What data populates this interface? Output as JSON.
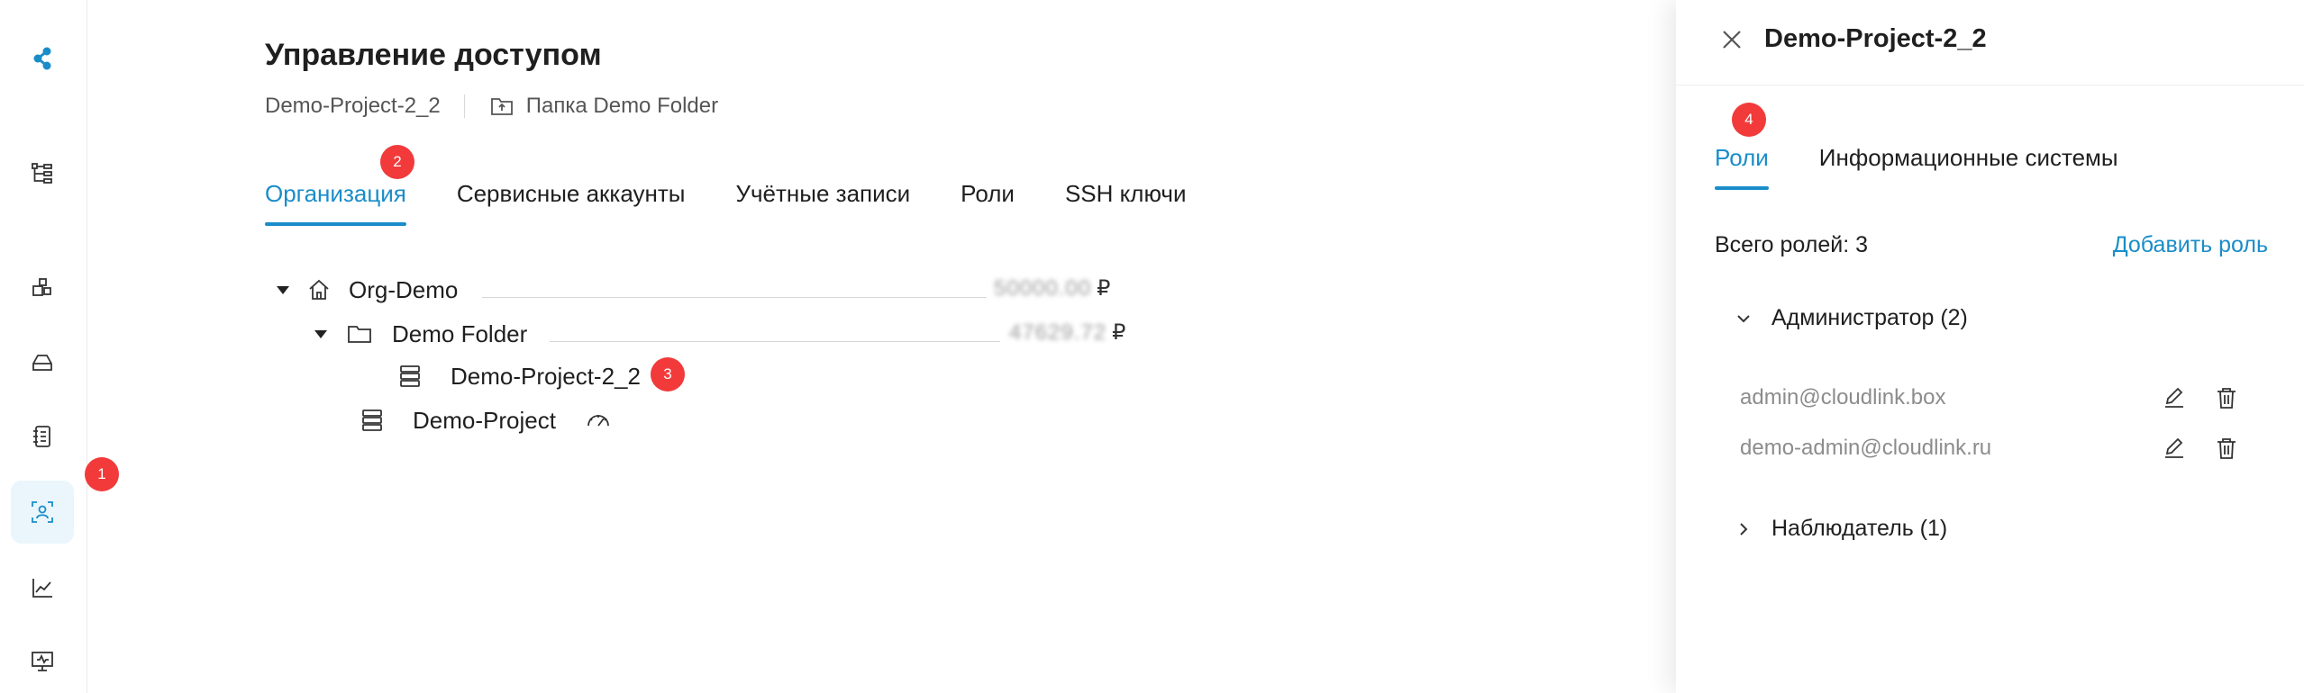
{
  "sidebar": {
    "items": [
      {
        "name": "logo"
      },
      {
        "name": "hierarchy"
      },
      {
        "name": "resources"
      },
      {
        "name": "storage"
      },
      {
        "name": "notebook"
      },
      {
        "name": "access"
      },
      {
        "name": "analytics"
      },
      {
        "name": "monitoring"
      }
    ],
    "active": "access"
  },
  "badges": {
    "b1": "1",
    "b2": "2",
    "b3": "3",
    "b4": "4"
  },
  "page": {
    "title": "Управление доступом",
    "breadcrumb_project": "Demo-Project-2_2",
    "breadcrumb_folder": "Папка Demo Folder"
  },
  "tabs": [
    {
      "label": "Организация",
      "active": true
    },
    {
      "label": "Сервисные аккаунты",
      "active": false
    },
    {
      "label": "Учётные записи",
      "active": false
    },
    {
      "label": "Роли",
      "active": false
    },
    {
      "label": "SSH ключи",
      "active": false
    }
  ],
  "tree": {
    "org": {
      "label": "Org-Demo",
      "amount": "50000.00",
      "currency": "₽"
    },
    "folder": {
      "label": "Demo Folder",
      "amount": "47629.72",
      "currency": "₽"
    },
    "project_selected": {
      "label": "Demo-Project-2_2"
    },
    "project": {
      "label": "Demo-Project"
    }
  },
  "drawer": {
    "title": "Demo-Project-2_2",
    "tabs": [
      {
        "label": "Роли",
        "active": true
      },
      {
        "label": "Информационные системы",
        "active": false
      }
    ],
    "summary": "Всего ролей: 3",
    "add_role": "Добавить роль",
    "groups": [
      {
        "label": "Администратор (2)",
        "expanded": true,
        "members": [
          "admin@cloudlink.box",
          "demo-admin@cloudlink.ru"
        ]
      },
      {
        "label": "Наблюдатель (1)",
        "expanded": false,
        "members": []
      }
    ]
  },
  "colors": {
    "accent": "#1a8dc9",
    "badge": "#f23a3a",
    "active_bg": "#eaf6fb"
  }
}
